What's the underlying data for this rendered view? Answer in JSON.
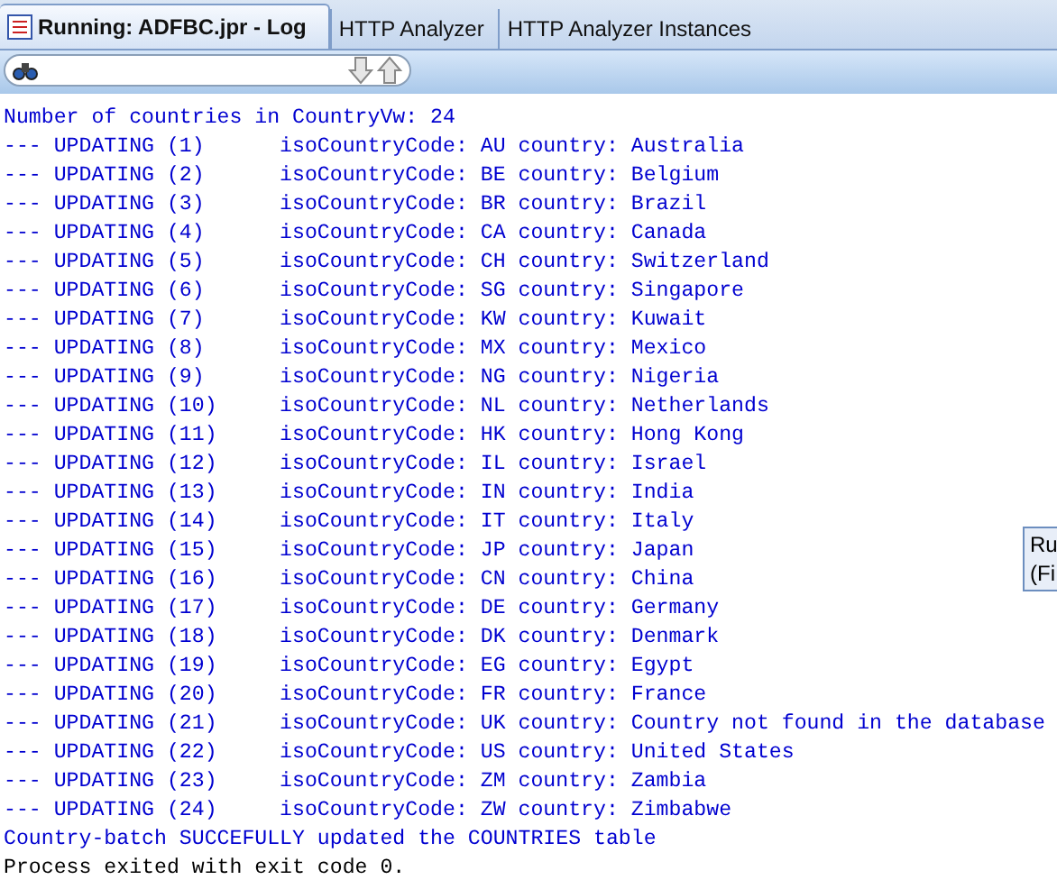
{
  "tabs": [
    {
      "label": "Running: ADFBC.jpr - Log",
      "selected": true,
      "kind": "log"
    },
    {
      "label": "HTTP Analyzer",
      "selected": false,
      "kind": "plain"
    },
    {
      "label": "HTTP Analyzer Instances",
      "selected": false,
      "kind": "plain"
    }
  ],
  "log_lines": [
    {
      "text": "Number of countries in CountryVw: 24",
      "kind": "info"
    },
    {
      "text": "--- UPDATING (1)      isoCountryCode: AU country: Australia",
      "kind": "info"
    },
    {
      "text": "--- UPDATING (2)      isoCountryCode: BE country: Belgium",
      "kind": "info"
    },
    {
      "text": "--- UPDATING (3)      isoCountryCode: BR country: Brazil",
      "kind": "info"
    },
    {
      "text": "--- UPDATING (4)      isoCountryCode: CA country: Canada",
      "kind": "info"
    },
    {
      "text": "--- UPDATING (5)      isoCountryCode: CH country: Switzerland",
      "kind": "info"
    },
    {
      "text": "--- UPDATING (6)      isoCountryCode: SG country: Singapore",
      "kind": "info"
    },
    {
      "text": "--- UPDATING (7)      isoCountryCode: KW country: Kuwait",
      "kind": "info"
    },
    {
      "text": "--- UPDATING (8)      isoCountryCode: MX country: Mexico",
      "kind": "info"
    },
    {
      "text": "--- UPDATING (9)      isoCountryCode: NG country: Nigeria",
      "kind": "info"
    },
    {
      "text": "--- UPDATING (10)     isoCountryCode: NL country: Netherlands",
      "kind": "info"
    },
    {
      "text": "--- UPDATING (11)     isoCountryCode: HK country: Hong Kong",
      "kind": "info"
    },
    {
      "text": "--- UPDATING (12)     isoCountryCode: IL country: Israel",
      "kind": "info"
    },
    {
      "text": "--- UPDATING (13)     isoCountryCode: IN country: India",
      "kind": "info"
    },
    {
      "text": "--- UPDATING (14)     isoCountryCode: IT country: Italy",
      "kind": "info"
    },
    {
      "text": "--- UPDATING (15)     isoCountryCode: JP country: Japan",
      "kind": "info"
    },
    {
      "text": "--- UPDATING (16)     isoCountryCode: CN country: China",
      "kind": "info"
    },
    {
      "text": "--- UPDATING (17)     isoCountryCode: DE country: Germany",
      "kind": "info"
    },
    {
      "text": "--- UPDATING (18)     isoCountryCode: DK country: Denmark",
      "kind": "info"
    },
    {
      "text": "--- UPDATING (19)     isoCountryCode: EG country: Egypt",
      "kind": "info"
    },
    {
      "text": "--- UPDATING (20)     isoCountryCode: FR country: France",
      "kind": "info"
    },
    {
      "text": "--- UPDATING (21)     isoCountryCode: UK country: Country not found in the database",
      "kind": "info"
    },
    {
      "text": "--- UPDATING (22)     isoCountryCode: US country: United States",
      "kind": "info"
    },
    {
      "text": "--- UPDATING (23)     isoCountryCode: ZM country: Zambia",
      "kind": "info"
    },
    {
      "text": "--- UPDATING (24)     isoCountryCode: ZW country: Zimbabwe",
      "kind": "info"
    },
    {
      "text": "Country-batch SUCCEFULLY updated the COUNTRIES table",
      "kind": "info"
    },
    {
      "text": "Process exited with exit code 0.",
      "kind": "plain"
    }
  ],
  "tooltip": {
    "lines": [
      "Ru",
      "(Fi"
    ]
  }
}
